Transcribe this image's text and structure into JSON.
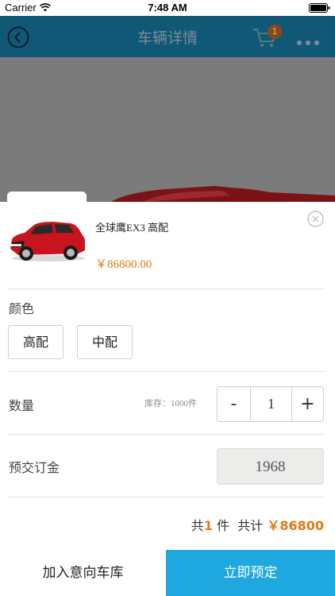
{
  "status_bar": {
    "carrier": "Carrier",
    "time": "7:48 AM",
    "icons": [
      "wifi-icon",
      "battery-icon"
    ]
  },
  "nav": {
    "title": "车辆详情",
    "cart_badge": "1",
    "icons": [
      "back-icon",
      "cart-icon",
      "more-icon"
    ]
  },
  "product": {
    "name": "全球鹰EX3 高配",
    "price": "￥86800.00",
    "thumbnail_icon": "red-suv-image"
  },
  "color_section": {
    "label": "颜色",
    "options": [
      "高配",
      "中配"
    ]
  },
  "quantity_section": {
    "label": "数量",
    "stock": "库存：1000件",
    "minus": "-",
    "value": "1",
    "plus": "+"
  },
  "deposit_section": {
    "label": "预交订金",
    "value": "1968"
  },
  "summary": {
    "prefix": "共",
    "count": "1",
    "unit": " 件",
    "total_label": "共计",
    "total": "￥86800"
  },
  "actions": {
    "add_to_garage": "加入意向车库",
    "reserve_now": "立即预定"
  },
  "colors": {
    "nav_bg": "#115877",
    "accent_orange": "#e07a14",
    "primary_blue": "#1fa8e0"
  }
}
